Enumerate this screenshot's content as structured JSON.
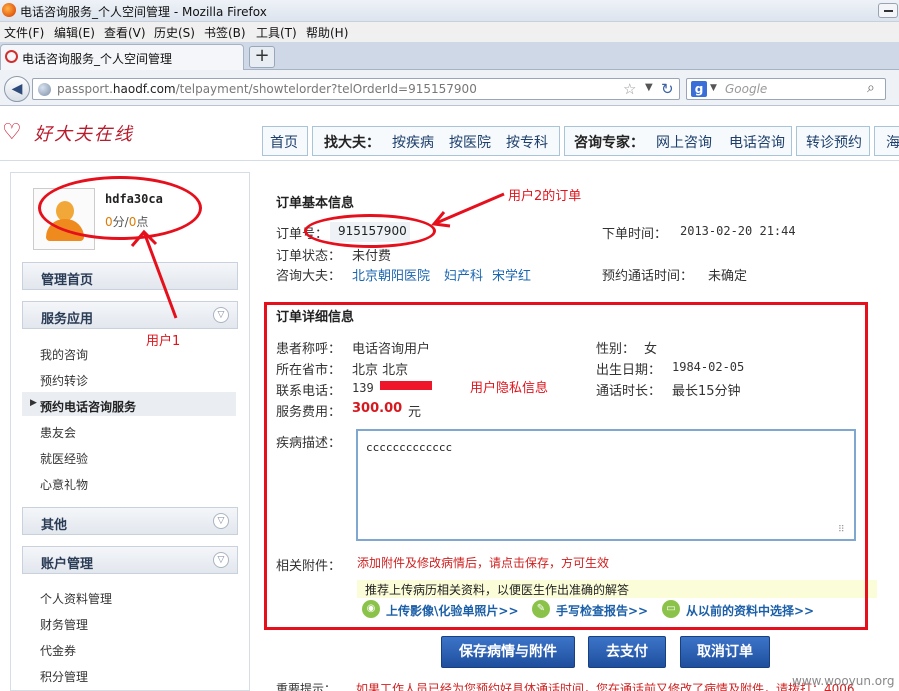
{
  "window": {
    "title": "电话咨询服务_个人空间管理 - Mozilla Firefox"
  },
  "menu": [
    "文件(F)",
    "编辑(E)",
    "查看(V)",
    "历史(S)",
    "书签(B)",
    "工具(T)",
    "帮助(H)"
  ],
  "tab": {
    "label": "电话咨询服务_个人空间管理",
    "new_tab": "+"
  },
  "address": {
    "prefix": "passport.",
    "domain": "haodf.com",
    "path": "/telpayment/showtelorder?telOrderId=915157900"
  },
  "search": {
    "placeholder": "Google",
    "engine_letter": "g"
  },
  "site": {
    "logo": "好大夫在线",
    "nav": [
      "首页",
      "找大夫：",
      "按疾病",
      "按医院",
      "按专科",
      "咨询专家：",
      "网上咨询",
      "电话咨询",
      "转诊预约",
      "海"
    ]
  },
  "user": {
    "name": "hdfa30ca",
    "score_a": "0",
    "score_sep1": "分/",
    "score_b": "0",
    "score_sep2": "点"
  },
  "sidebar": {
    "sections": {
      "home": "管理首页",
      "services": "服务应用",
      "other": "其他",
      "account": "账户管理"
    },
    "service_items": [
      "我的咨询",
      "预约转诊",
      "预约电话咨询服务",
      "患友会",
      "就医经验",
      "心意礼物"
    ],
    "account_items": [
      "个人资料管理",
      "财务管理",
      "代金券",
      "积分管理"
    ]
  },
  "order_basic": {
    "title": "订单基本信息",
    "order_no_label": "订单号：",
    "order_no": "915157900",
    "order_time_label": "下单时间：",
    "order_time": "2013-02-20 21:44",
    "status_label": "订单状态：",
    "status": "未付费",
    "doctor_label": "咨询大夫：",
    "hospital": "北京朝阳医院",
    "department": "妇产科",
    "doctor": "宋学红",
    "call_time_label": "预约通话时间：",
    "call_time": "未确定"
  },
  "order_detail": {
    "title": "订单详细信息",
    "patient_label": "患者称呼：",
    "patient": "电话咨询用户",
    "gender_label": "性别：",
    "gender": "女",
    "region_label": "所在省市：",
    "region": "北京 北京",
    "birth_label": "出生日期：",
    "birth": "1984-02-05",
    "phone_label": "联系电话：",
    "phone": "139",
    "duration_label": "通话时长：",
    "duration": "最长15分钟",
    "fee_label": "服务费用：",
    "fee": "300.00",
    "fee_unit": "元",
    "desc_label": "疾病描述：",
    "desc": "ccccccccccccc",
    "attach_label": "相关附件：",
    "attach_warn": "添加附件及修改病情后，请点击保存，方可生效",
    "attach_tip": "推荐上传病历相关资料，以便医生作出准确的解答",
    "upload_image": "上传影像\\化验单照片>>",
    "handwrite": "手写检查报告>>",
    "choose_previous": "从以前的资料中选择>>"
  },
  "buttons": {
    "save": "保存病情与附件",
    "pay": "去支付",
    "cancel": "取消订单"
  },
  "notice": {
    "label": "重要提示：",
    "text": "如果工作人员已经为您预约好具体通话时间，您在通话前又修改了病情及附件，请拨打：4006"
  },
  "annotations": {
    "user1": "用户1",
    "user2_order": "用户2的订单",
    "privacy": "用户隐私信息"
  },
  "watermark": "www.wooyun.org"
}
